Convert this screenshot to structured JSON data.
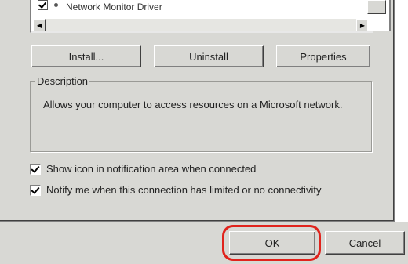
{
  "components": {
    "visible_item": "Network Monitor Driver",
    "item_checked": true
  },
  "buttons": {
    "install": "Install...",
    "uninstall": "Uninstall",
    "properties": "Properties"
  },
  "description": {
    "legend": "Description",
    "text": "Allows your computer to access resources on a Microsoft network."
  },
  "options": [
    {
      "label": "Show icon in notification area when connected",
      "checked": true
    },
    {
      "label": "Notify me when this connection has limited or no connectivity",
      "checked": true
    }
  ],
  "dialog_buttons": {
    "ok": "OK",
    "cancel": "Cancel"
  },
  "colors": {
    "dialog_face": "#d8d8d4",
    "highlight": "#e0231c"
  }
}
